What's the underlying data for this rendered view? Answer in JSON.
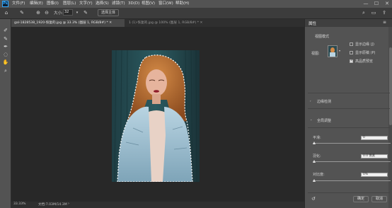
{
  "menubar": {
    "logo": "Ps",
    "items": [
      "文件(F)",
      "编辑(E)",
      "图像(I)",
      "图层(L)",
      "文字(Y)",
      "选择(S)",
      "滤镜(T)",
      "3D(D)",
      "视图(V)",
      "窗口(W)",
      "帮助(H)"
    ],
    "window_controls": [
      "—",
      "☐",
      "✕"
    ]
  },
  "options": {
    "size_label": "大小:",
    "size_value": "32",
    "select_subject": "选择主体"
  },
  "tabs": [
    {
      "label": "gal-1828538_1920-恢复的.jpg @ 33.3% (图层 1, RGB/8#) * ✕"
    },
    {
      "label": "1 (1)-恢复的.jpg @ 100% (图层 1, RGB/8#) * ✕"
    }
  ],
  "status": {
    "zoom": "33.33%",
    "doc": "文档:7.03M/14.3M"
  },
  "panel": {
    "title": "属性",
    "view_mode_heading": "视图模式",
    "view_label": "视图:",
    "show_edge": "显示边缘 (J)",
    "show_original": "显示原稿 (P)",
    "hq_preview": "高品质预览",
    "edge_detection": "边缘检测",
    "global_refine": "全局调整",
    "smooth_label": "平滑:",
    "smooth_value": "0",
    "feather_label": "羽化:",
    "feather_value": "0.0 像素",
    "contrast_label": "对比度:",
    "contrast_value": "0%",
    "ok": "确定",
    "cancel": "取消"
  },
  "colors": {
    "accent": "#31a8ff",
    "ui_dark": "#282828",
    "panel": "#535353"
  }
}
